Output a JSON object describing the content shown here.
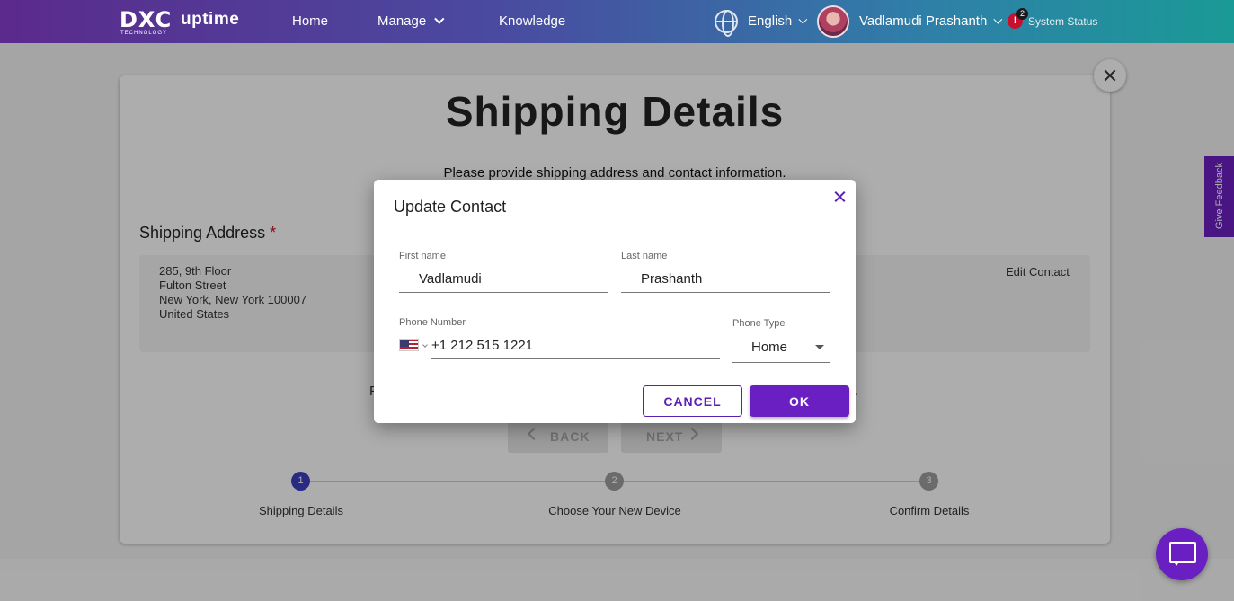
{
  "header": {
    "logo_dxc": "DXC",
    "logo_tech": "TECHNOLOGY",
    "logo_uptime": "uptime",
    "nav": {
      "home": "Home",
      "manage": "Manage",
      "knowledge": "Knowledge"
    },
    "language": "English",
    "username": "Vadlamudi Prashanth",
    "status_count": "2",
    "status_label": "System Status"
  },
  "page": {
    "title": "Shipping Details",
    "subtitle": "Please provide shipping address and contact information.",
    "section_title": "Shipping Address",
    "required_mark": "*",
    "address_lines": [
      "285, 9th Floor",
      "Fulton Street",
      "New York, New York 100007",
      "United States"
    ],
    "edit_contact": "Edit Contact",
    "back_label": "BACK",
    "next_label": "NEXT",
    "partial_left": "P",
    "partial_right": ".",
    "steps": [
      {
        "number": "1",
        "label": "Shipping Details",
        "state": "active"
      },
      {
        "number": "2",
        "label": "Choose Your New Device",
        "state": "todo"
      },
      {
        "number": "3",
        "label": "Confirm Details",
        "state": "todo"
      }
    ]
  },
  "feedback_tab": "Give Feedback",
  "modal": {
    "title": "Update Contact",
    "first_name_label": "First name",
    "first_name_value": "Vadlamudi",
    "last_name_label": "Last name",
    "last_name_value": "Prashanth",
    "phone_label": "Phone Number",
    "phone_value": "+1 212 515 1221",
    "phone_type_label": "Phone Type",
    "phone_type_value": "Home",
    "cancel_label": "CANCEL",
    "ok_label": "OK"
  },
  "colors": {
    "accent": "#6a1fc2",
    "step_active": "#3b3fc2",
    "required": "#c8102e"
  }
}
